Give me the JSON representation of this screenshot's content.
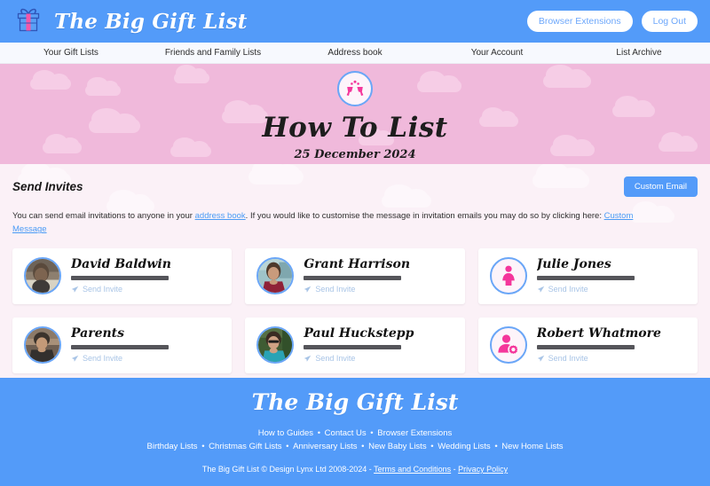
{
  "header": {
    "logo_icon": "gift-box-icon",
    "brand_title": "The Big Gift List",
    "buttons": [
      {
        "label": "Browser Extensions",
        "name": "browser-extensions-button"
      },
      {
        "label": "Log Out",
        "name": "log-out-button"
      }
    ]
  },
  "nav": {
    "items": [
      {
        "label": "Your Gift Lists"
      },
      {
        "label": "Friends and Family Lists"
      },
      {
        "label": "Address book"
      },
      {
        "label": "Your Account"
      },
      {
        "label": "List Archive"
      }
    ]
  },
  "banner": {
    "icon": "champagne-glasses-icon",
    "title": "How To List",
    "date": "25 December 2024"
  },
  "main": {
    "section_title": "Send Invites",
    "custom_email_label": "Custom Email",
    "blurb_part1": "You can send email invitations to anyone in your ",
    "blurb_link1": "address book",
    "blurb_part2": ". If you would like to customise the message in invitation emails you may do so by clicking here: ",
    "blurb_link2": "Custom Message",
    "send_invite_label": "Send Invite",
    "contacts": [
      {
        "name": "David Baldwin",
        "avatar_type": "photo",
        "photo_id": "photo-david"
      },
      {
        "name": "Grant Harrison",
        "avatar_type": "photo",
        "photo_id": "photo-grant"
      },
      {
        "name": "Julie Jones",
        "avatar_type": "icon",
        "icon": "female-person-icon"
      },
      {
        "name": "Parents",
        "avatar_type": "photo",
        "photo_id": "photo-parents"
      },
      {
        "name": "Paul Huckstepp",
        "avatar_type": "photo",
        "photo_id": "photo-paul"
      },
      {
        "name": "Robert Whatmore",
        "avatar_type": "icon",
        "icon": "user-settings-icon"
      }
    ]
  },
  "footer": {
    "title": "The Big Gift List",
    "row1": [
      "How to Guides",
      "Contact Us",
      "Browser Extensions"
    ],
    "row2": [
      "Birthday Lists",
      "Christmas Gift Lists",
      "Anniversary Lists",
      "New Baby Lists",
      "Wedding Lists",
      "New Home Lists"
    ],
    "copyright": "The Big Gift List © Design Lynx Ltd 2008-2024 - ",
    "terms_label": "Terms and Conditions",
    "copy_sep": " - ",
    "privacy_label": "Privacy Policy"
  },
  "colors": {
    "brand_blue": "#539bf9",
    "banner_pink": "#f0b9db",
    "body_pink": "#fbf1f7",
    "accent_pink": "#f4369b",
    "link_blue": "#4a9bf5"
  }
}
